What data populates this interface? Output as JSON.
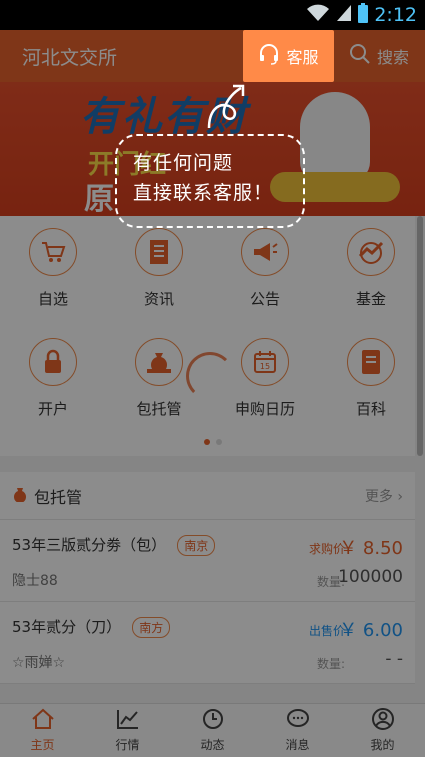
{
  "status_bar": {
    "time": "2:12"
  },
  "header": {
    "title": "河北文交所",
    "search_label": "搜索"
  },
  "banner": {
    "line1": "有礼有财",
    "line2": "开门红",
    "line3": "原"
  },
  "grid": [
    {
      "label": "自选",
      "icon": "cart-icon"
    },
    {
      "label": "资讯",
      "icon": "news-icon"
    },
    {
      "label": "公告",
      "icon": "megaphone-icon"
    },
    {
      "label": "基金",
      "icon": "fund-icon"
    },
    {
      "label": "开户",
      "icon": "lock-icon"
    },
    {
      "label": "包托管",
      "icon": "moneybag-icon"
    },
    {
      "label": "申购日历",
      "icon": "calendar-icon"
    },
    {
      "label": "百科",
      "icon": "book-icon"
    }
  ],
  "calendar_day": "15",
  "section": {
    "title": "包托管",
    "more": "更多",
    "rows": [
      {
        "name": "53年三版贰分劵（包）",
        "tag": "南京",
        "seller": "隐士88",
        "price_label": "求购价",
        "price": "￥ 8.50",
        "qty_label": "数量:",
        "qty": "100000",
        "type": "buy"
      },
      {
        "name": "53年贰分（刀）",
        "tag": "南方",
        "seller": "☆雨婵☆",
        "price_label": "出售价",
        "price": "￥ 6.00",
        "qty_label": "数量:",
        "qty": "- -",
        "type": "sell"
      }
    ]
  },
  "nav": [
    {
      "label": "主页",
      "icon": "home-icon",
      "active": true
    },
    {
      "label": "行情",
      "icon": "chart-icon",
      "active": false
    },
    {
      "label": "动态",
      "icon": "clock-icon",
      "active": false
    },
    {
      "label": "消息",
      "icon": "message-icon",
      "active": false
    },
    {
      "label": "我的",
      "icon": "user-icon",
      "active": false
    }
  ],
  "overlay": {
    "cs_label": "客服",
    "tip_line1": "有任何问题",
    "tip_line2": "直接联系客服！"
  }
}
